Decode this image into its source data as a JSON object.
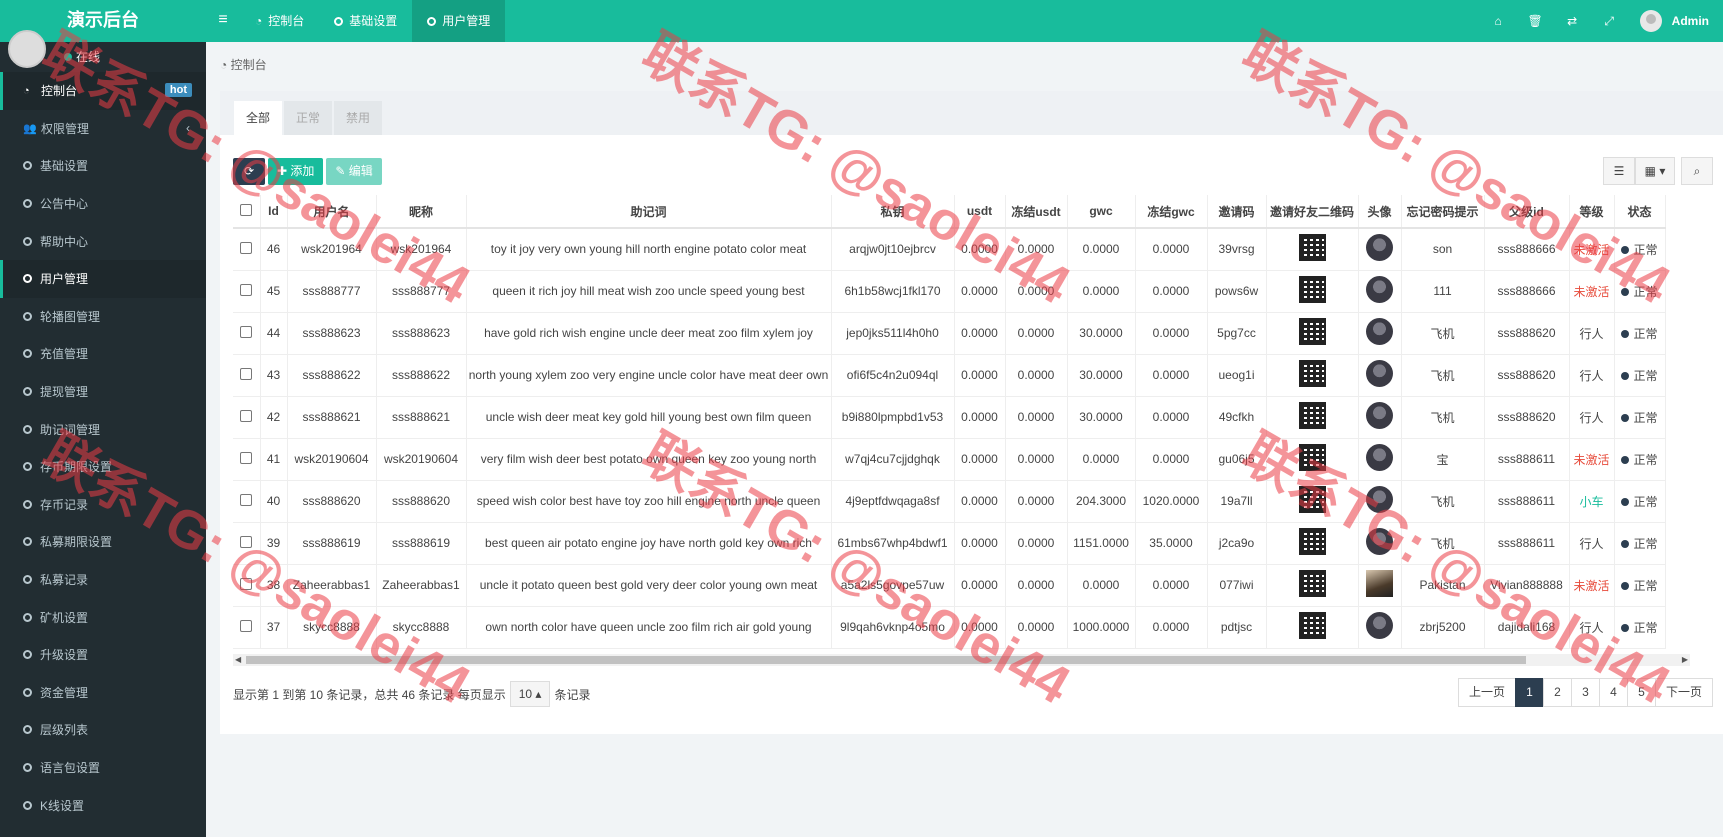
{
  "header": {
    "logo": "演示后台",
    "toggle_icon": "≡",
    "tabs": [
      {
        "label": "控制台",
        "icon": "dashboard-icon"
      },
      {
        "label": "基础设置",
        "icon": "circle-icon"
      },
      {
        "label": "用户管理",
        "icon": "circle-icon"
      }
    ],
    "right_icons": [
      "home-icon",
      "trash-icon",
      "translate-icon",
      "fullscreen-icon"
    ],
    "user": "Admin"
  },
  "sidebar": {
    "status": "在线",
    "items": [
      {
        "label": "控制台",
        "badge": "hot"
      },
      {
        "label": "权限管理"
      },
      {
        "label": "基础设置"
      },
      {
        "label": "公告中心"
      },
      {
        "label": "帮助中心"
      },
      {
        "label": "用户管理"
      },
      {
        "label": "轮播图管理"
      },
      {
        "label": "充值管理"
      },
      {
        "label": "提现管理"
      },
      {
        "label": "助记词管理"
      },
      {
        "label": "存币期限设置"
      },
      {
        "label": "存币记录"
      },
      {
        "label": "私募期限设置"
      },
      {
        "label": "私募记录"
      },
      {
        "label": "矿机设置"
      },
      {
        "label": "升级设置"
      },
      {
        "label": "资金管理"
      },
      {
        "label": "层级列表"
      },
      {
        "label": "语言包设置"
      },
      {
        "label": "K线设置"
      }
    ]
  },
  "breadcrumb": "控制台",
  "filter_tabs": [
    "全部",
    "正常",
    "禁用"
  ],
  "toolbar": {
    "add": "添加",
    "edit": "编辑"
  },
  "table": {
    "columns": [
      "Id",
      "用户名",
      "昵称",
      "助记词",
      "私钥",
      "usdt",
      "冻结usdt",
      "gwc",
      "冻结gwc",
      "邀请码",
      "邀请好友二维码",
      "头像",
      "忘记密码提示",
      "父级id",
      "等级",
      "状态"
    ],
    "rows": [
      {
        "id": "46",
        "username": "wsk201964",
        "nickname": "wsk201964",
        "mnemonic": "toy it joy very own young hill north engine potato color meat",
        "key": "arqjw0jt10ejbrcv",
        "usdt": "0.0000",
        "fusdt": "0.0000",
        "gwc": "0.0000",
        "fgwc": "0.0000",
        "code": "39vrsg",
        "hint": "son",
        "parent": "sss888666",
        "level": "未激活",
        "status": "正常"
      },
      {
        "id": "45",
        "username": "sss888777",
        "nickname": "sss888777",
        "mnemonic": "queen it rich joy hill meat wish zoo uncle speed young best",
        "key": "6h1b58wcj1fkl170",
        "usdt": "0.0000",
        "fusdt": "0.0000",
        "gwc": "0.0000",
        "fgwc": "0.0000",
        "code": "pows6w",
        "hint": "111",
        "parent": "sss888666",
        "level": "未激活",
        "status": "正常"
      },
      {
        "id": "44",
        "username": "sss888623",
        "nickname": "sss888623",
        "mnemonic": "have gold rich wish engine uncle deer meat zoo film xylem joy",
        "key": "jep0jks511l4h0h0",
        "usdt": "0.0000",
        "fusdt": "0.0000",
        "gwc": "30.0000",
        "fgwc": "0.0000",
        "code": "5pg7cc",
        "hint": "飞机",
        "parent": "sss888620",
        "level": "行人",
        "status": "正常"
      },
      {
        "id": "43",
        "username": "sss888622",
        "nickname": "sss888622",
        "mnemonic": "north young xylem zoo very engine uncle color have meat deer own",
        "key": "ofi6f5c4n2u094ql",
        "usdt": "0.0000",
        "fusdt": "0.0000",
        "gwc": "30.0000",
        "fgwc": "0.0000",
        "code": "ueog1i",
        "hint": "飞机",
        "parent": "sss888620",
        "level": "行人",
        "status": "正常"
      },
      {
        "id": "42",
        "username": "sss888621",
        "nickname": "sss888621",
        "mnemonic": "uncle wish deer meat key gold hill young best own film queen",
        "key": "b9i880lpmpbd1v53",
        "usdt": "0.0000",
        "fusdt": "0.0000",
        "gwc": "30.0000",
        "fgwc": "0.0000",
        "code": "49cfkh",
        "hint": "飞机",
        "parent": "sss888620",
        "level": "行人",
        "status": "正常"
      },
      {
        "id": "41",
        "username": "wsk20190604",
        "nickname": "wsk20190604",
        "mnemonic": "very film wish deer best potato own queen key zoo young north",
        "key": "w7qj4cu7cjjdghqk",
        "usdt": "0.0000",
        "fusdt": "0.0000",
        "gwc": "0.0000",
        "fgwc": "0.0000",
        "code": "gu06j5",
        "hint": "宝",
        "parent": "sss888611",
        "level": "未激活",
        "status": "正常"
      },
      {
        "id": "40",
        "username": "sss888620",
        "nickname": "sss888620",
        "mnemonic": "speed wish color best have toy zoo hill engine north uncle queen",
        "key": "4j9eptfdwqaga8sf",
        "usdt": "0.0000",
        "fusdt": "0.0000",
        "gwc": "204.3000",
        "fgwc": "1020.0000",
        "code": "19a7ll",
        "hint": "飞机",
        "parent": "sss888611",
        "level": "小车",
        "status": "正常"
      },
      {
        "id": "39",
        "username": "sss888619",
        "nickname": "sss888619",
        "mnemonic": "best queen air potato engine joy have north gold key own rich",
        "key": "61mbs67whp4bdwf1",
        "usdt": "0.0000",
        "fusdt": "0.0000",
        "gwc": "1151.0000",
        "fgwc": "35.0000",
        "code": "j2ca9o",
        "hint": "飞机",
        "parent": "sss888611",
        "level": "行人",
        "status": "正常"
      },
      {
        "id": "38",
        "username": "Zaheerabbas1",
        "nickname": "Zaheerabbas1",
        "mnemonic": "uncle it potato queen best gold very deer color young own meat",
        "key": "a5a2ls5govpe57uw",
        "usdt": "0.0000",
        "fusdt": "0.0000",
        "gwc": "0.0000",
        "fgwc": "0.0000",
        "code": "077iwi",
        "hint": "Pakistan",
        "parent": "Vivian888888",
        "level": "未激活",
        "status": "正常"
      },
      {
        "id": "37",
        "username": "skycc8888",
        "nickname": "skycc8888",
        "mnemonic": "own north color have queen uncle zoo film rich air gold young",
        "key": "9l9qah6vknp4o5mo",
        "usdt": "0.0000",
        "fusdt": "0.0000",
        "gwc": "1000.0000",
        "fgwc": "0.0000",
        "code": "pdtjsc",
        "hint": "zbrj5200",
        "parent": "dajidali168",
        "level": "行人",
        "status": "正常"
      }
    ]
  },
  "pagination": {
    "summary": "显示第 1 到第 10 条记录，总共 46 条记录 每页显示",
    "page_size": "10",
    "suffix": "条记录",
    "prev": "上一页",
    "pages": [
      "1",
      "2",
      "3",
      "4",
      "5"
    ],
    "next": "下一页"
  },
  "watermark": "联系TG: @saolei44",
  "colors": {
    "brand": "#18bc9c",
    "sidebar": "#222d32",
    "danger": "#e74c3c"
  }
}
